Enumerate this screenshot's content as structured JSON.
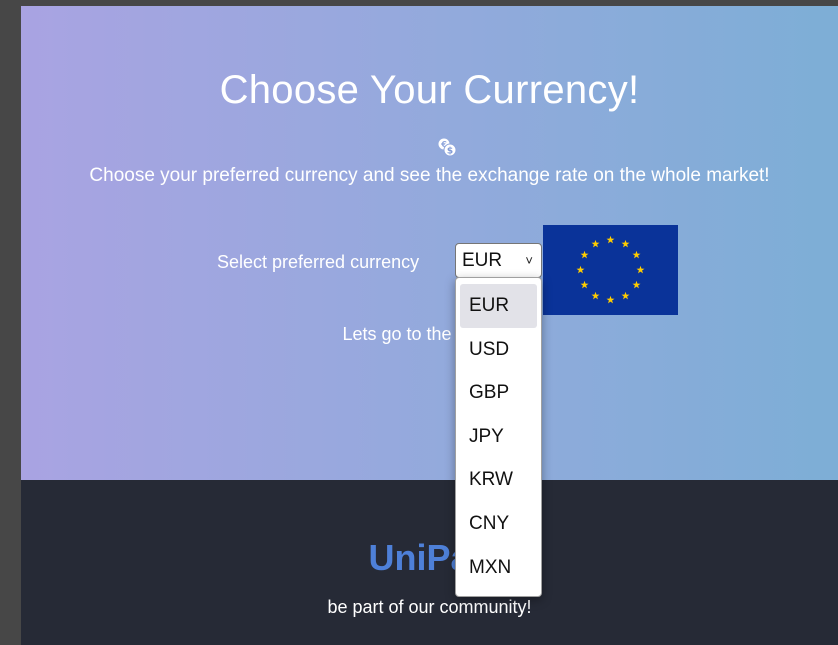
{
  "hero": {
    "title": "Choose Your Currency!",
    "subtitle": "Choose your preferred currency and see the exchange rate on the whole market!",
    "select_label": "Select preferred currency",
    "cta_text": "Lets go to the market!",
    "coin_icon": "coins-icon",
    "gradient_colors": [
      "#a9a3e2",
      "#7daed6"
    ]
  },
  "currency_select": {
    "selected": "EUR",
    "options": [
      "EUR",
      "USD",
      "GBP",
      "JPY",
      "KRW",
      "CNY",
      "MXN"
    ],
    "flag": "eu-flag"
  },
  "footer": {
    "brand": "UniPay",
    "text": "be part of our community!",
    "brand_color": "#4e80d8",
    "background": "#262a36"
  }
}
